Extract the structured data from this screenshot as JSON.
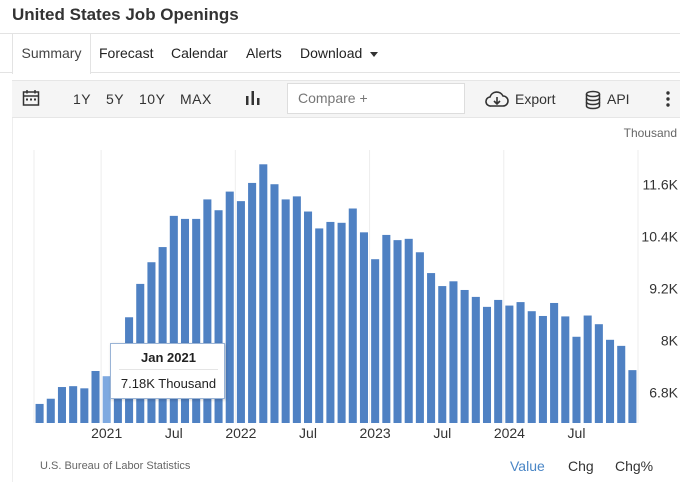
{
  "page": {
    "title": "United States Job Openings"
  },
  "tabs": [
    {
      "label": "Summary",
      "active": true
    },
    {
      "label": "Forecast"
    },
    {
      "label": "Calendar"
    },
    {
      "label": "Alerts"
    },
    {
      "label": "Download"
    }
  ],
  "toolbar": {
    "calendar_icon": "calendar-icon",
    "ranges": [
      "1Y",
      "5Y",
      "10Y",
      "MAX"
    ],
    "chart_type_icon": "bar-chart-icon",
    "compare_placeholder": "Compare +",
    "export_label": "Export",
    "export_icon": "cloud-download-icon",
    "api_label": "API",
    "api_icon": "database-icon",
    "more_icon": "more-vertical-icon"
  },
  "tooltip": {
    "date": "Jan 2021",
    "value": "7.18K Thousand"
  },
  "footer": {
    "source": "U.S. Bureau of Labor Statistics",
    "links": [
      "Value",
      "Chg",
      "Chg%"
    ],
    "active_link": "Value"
  },
  "colors": {
    "bar": "#4f81c3",
    "bar_highlight": "#7ea9e0",
    "grid": "#eeeeee",
    "accent": "#4a86c6"
  },
  "chart_data": {
    "type": "bar",
    "unit": "Thousand",
    "x_tick_labels": [
      "2021",
      "Jul",
      "2022",
      "Jul",
      "2023",
      "Jul",
      "2024",
      "Jul"
    ],
    "y_tick_labels": [
      "11.6K",
      "10.4K",
      "9.2K",
      "8K",
      "6.8K"
    ],
    "y_ticks": [
      11600,
      10400,
      9200,
      8000,
      6800
    ],
    "ylim": [
      6100,
      12400
    ],
    "grid": true,
    "highlighted_category": "Jan 2021",
    "categories": [
      "Jul 2020",
      "Aug 2020",
      "Sep 2020",
      "Oct 2020",
      "Nov 2020",
      "Dec 2020",
      "Jan 2021",
      "Feb 2021",
      "Mar 2021",
      "Apr 2021",
      "May 2021",
      "Jun 2021",
      "Jul 2021",
      "Aug 2021",
      "Sep 2021",
      "Oct 2021",
      "Nov 2021",
      "Dec 2021",
      "Jan 2022",
      "Feb 2022",
      "Mar 2022",
      "Apr 2022",
      "May 2022",
      "Jun 2022",
      "Jul 2022",
      "Aug 2022",
      "Sep 2022",
      "Oct 2022",
      "Nov 2022",
      "Dec 2022",
      "Jan 2023",
      "Feb 2023",
      "Mar 2023",
      "Apr 2023",
      "May 2023",
      "Jun 2023",
      "Jul 2023",
      "Aug 2023",
      "Sep 2023",
      "Oct 2023",
      "Nov 2023",
      "Dec 2023",
      "Jan 2024",
      "Feb 2024",
      "Mar 2024",
      "Apr 2024",
      "May 2024",
      "Jun 2024",
      "Jul 2024"
    ],
    "values": [
      6540,
      6660,
      6930,
      6950,
      6900,
      7300,
      7180,
      7580,
      8540,
      9310,
      9810,
      10160,
      10880,
      10810,
      10810,
      11260,
      11010,
      11440,
      11220,
      11640,
      12070,
      11610,
      11260,
      11330,
      10980,
      10590,
      10740,
      10720,
      11050,
      10500,
      9880,
      10440,
      10320,
      10350,
      10040,
      9560,
      9260,
      9370,
      9170,
      9010,
      8780,
      8940,
      8810,
      8890,
      8680,
      8570,
      8870,
      8560,
      8090,
      8580,
      8380,
      8020,
      7880,
      7320
    ]
  }
}
